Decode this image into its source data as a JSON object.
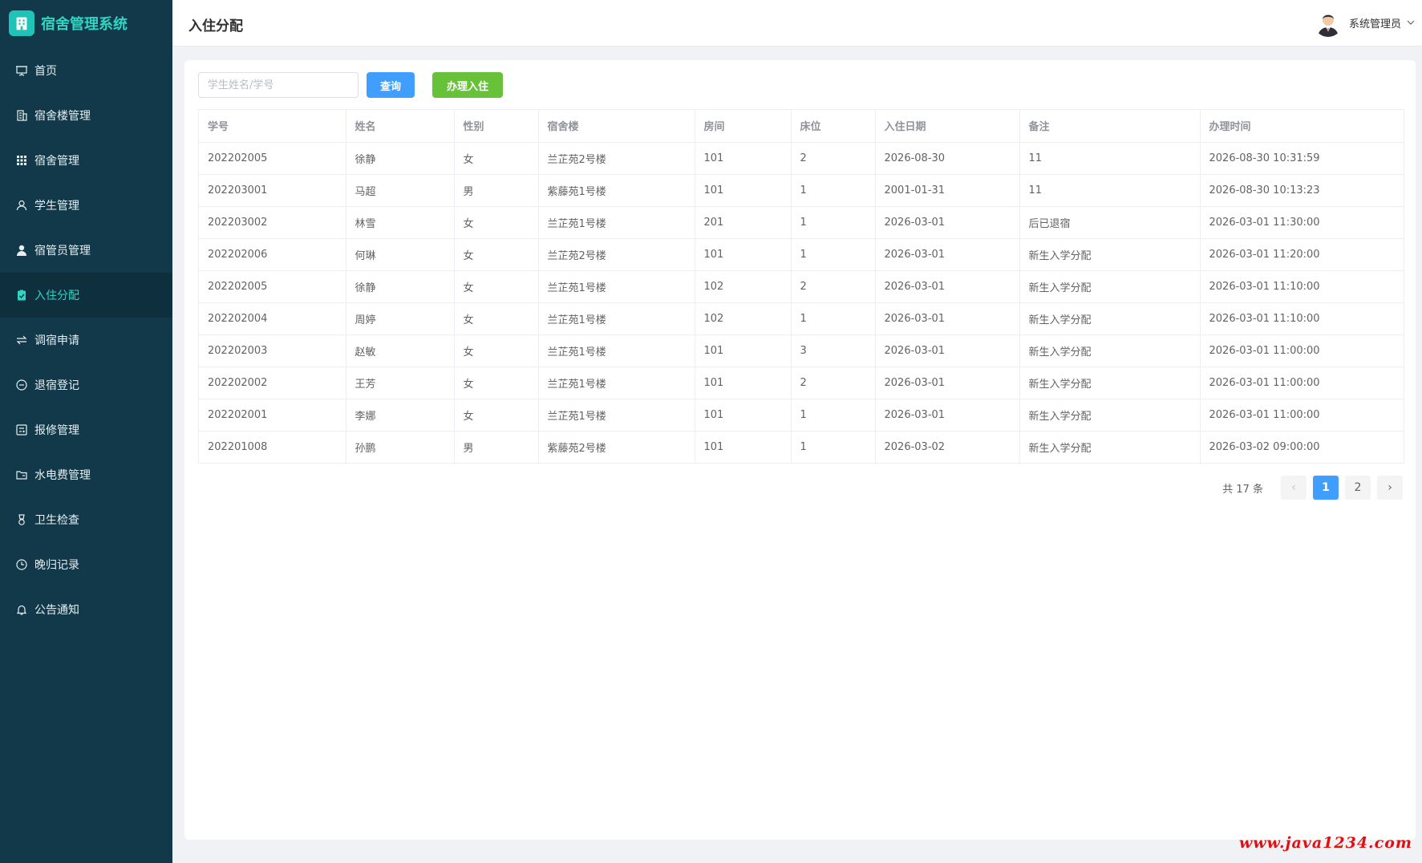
{
  "brand": {
    "title": "宿舍管理系统"
  },
  "sidebar": {
    "items": [
      {
        "label": "首页",
        "icon": "presentation-icon",
        "active": false
      },
      {
        "label": "宿舍楼管理",
        "icon": "building-icon",
        "active": false
      },
      {
        "label": "宿舍管理",
        "icon": "grid-icon",
        "active": false
      },
      {
        "label": "学生管理",
        "icon": "user-icon",
        "active": false
      },
      {
        "label": "宿管员管理",
        "icon": "user-solid-icon",
        "active": false
      },
      {
        "label": "入住分配",
        "icon": "clipboard-check-icon",
        "active": true
      },
      {
        "label": "调宿申请",
        "icon": "swap-icon",
        "active": false
      },
      {
        "label": "退宿登记",
        "icon": "minus-circle-icon",
        "active": false
      },
      {
        "label": "报修管理",
        "icon": "tools-icon",
        "active": false
      },
      {
        "label": "水电费管理",
        "icon": "folder-icon",
        "active": false
      },
      {
        "label": "卫生检查",
        "icon": "medal-icon",
        "active": false
      },
      {
        "label": "晚归记录",
        "icon": "clock-icon",
        "active": false
      },
      {
        "label": "公告通知",
        "icon": "bell-icon",
        "active": false
      }
    ]
  },
  "header": {
    "title": "入住分配",
    "user_name": "系统管理员"
  },
  "toolbar": {
    "search_placeholder": "学生姓名/学号",
    "query_label": "查询",
    "checkin_label": "办理入住"
  },
  "table": {
    "columns": [
      "学号",
      "姓名",
      "性别",
      "宿舍楼",
      "房间",
      "床位",
      "入住日期",
      "备注",
      "办理时间"
    ],
    "rows": [
      [
        "202202005",
        "徐静",
        "女",
        "兰芷苑2号楼",
        "101",
        "2",
        "2026-08-30",
        "11",
        "2026-08-30 10:31:59"
      ],
      [
        "202203001",
        "马超",
        "男",
        "紫藤苑1号楼",
        "101",
        "1",
        "2001-01-31",
        "11",
        "2026-08-30 10:13:23"
      ],
      [
        "202203002",
        "林雪",
        "女",
        "兰芷苑1号楼",
        "201",
        "1",
        "2026-03-01",
        "后已退宿",
        "2026-03-01 11:30:00"
      ],
      [
        "202202006",
        "何琳",
        "女",
        "兰芷苑2号楼",
        "101",
        "1",
        "2026-03-01",
        "新生入学分配",
        "2026-03-01 11:20:00"
      ],
      [
        "202202005",
        "徐静",
        "女",
        "兰芷苑1号楼",
        "102",
        "2",
        "2026-03-01",
        "新生入学分配",
        "2026-03-01 11:10:00"
      ],
      [
        "202202004",
        "周婷",
        "女",
        "兰芷苑1号楼",
        "102",
        "1",
        "2026-03-01",
        "新生入学分配",
        "2026-03-01 11:10:00"
      ],
      [
        "202202003",
        "赵敏",
        "女",
        "兰芷苑1号楼",
        "101",
        "3",
        "2026-03-01",
        "新生入学分配",
        "2026-03-01 11:00:00"
      ],
      [
        "202202002",
        "王芳",
        "女",
        "兰芷苑1号楼",
        "101",
        "2",
        "2026-03-01",
        "新生入学分配",
        "2026-03-01 11:00:00"
      ],
      [
        "202202001",
        "李娜",
        "女",
        "兰芷苑1号楼",
        "101",
        "1",
        "2026-03-01",
        "新生入学分配",
        "2026-03-01 11:00:00"
      ],
      [
        "202201008",
        "孙鹏",
        "男",
        "紫藤苑2号楼",
        "101",
        "1",
        "2026-03-02",
        "新生入学分配",
        "2026-03-02 09:00:00"
      ]
    ]
  },
  "pagination": {
    "total_text": "共 17 条",
    "prev": "‹",
    "next": "›",
    "pages": [
      "1",
      "2"
    ],
    "current": "1"
  },
  "watermark": "www.java1234.com",
  "colors": {
    "sidebar_bg": "#11394a",
    "accent": "#2fd4c3",
    "primary": "#409eff",
    "success": "#67c23a"
  }
}
